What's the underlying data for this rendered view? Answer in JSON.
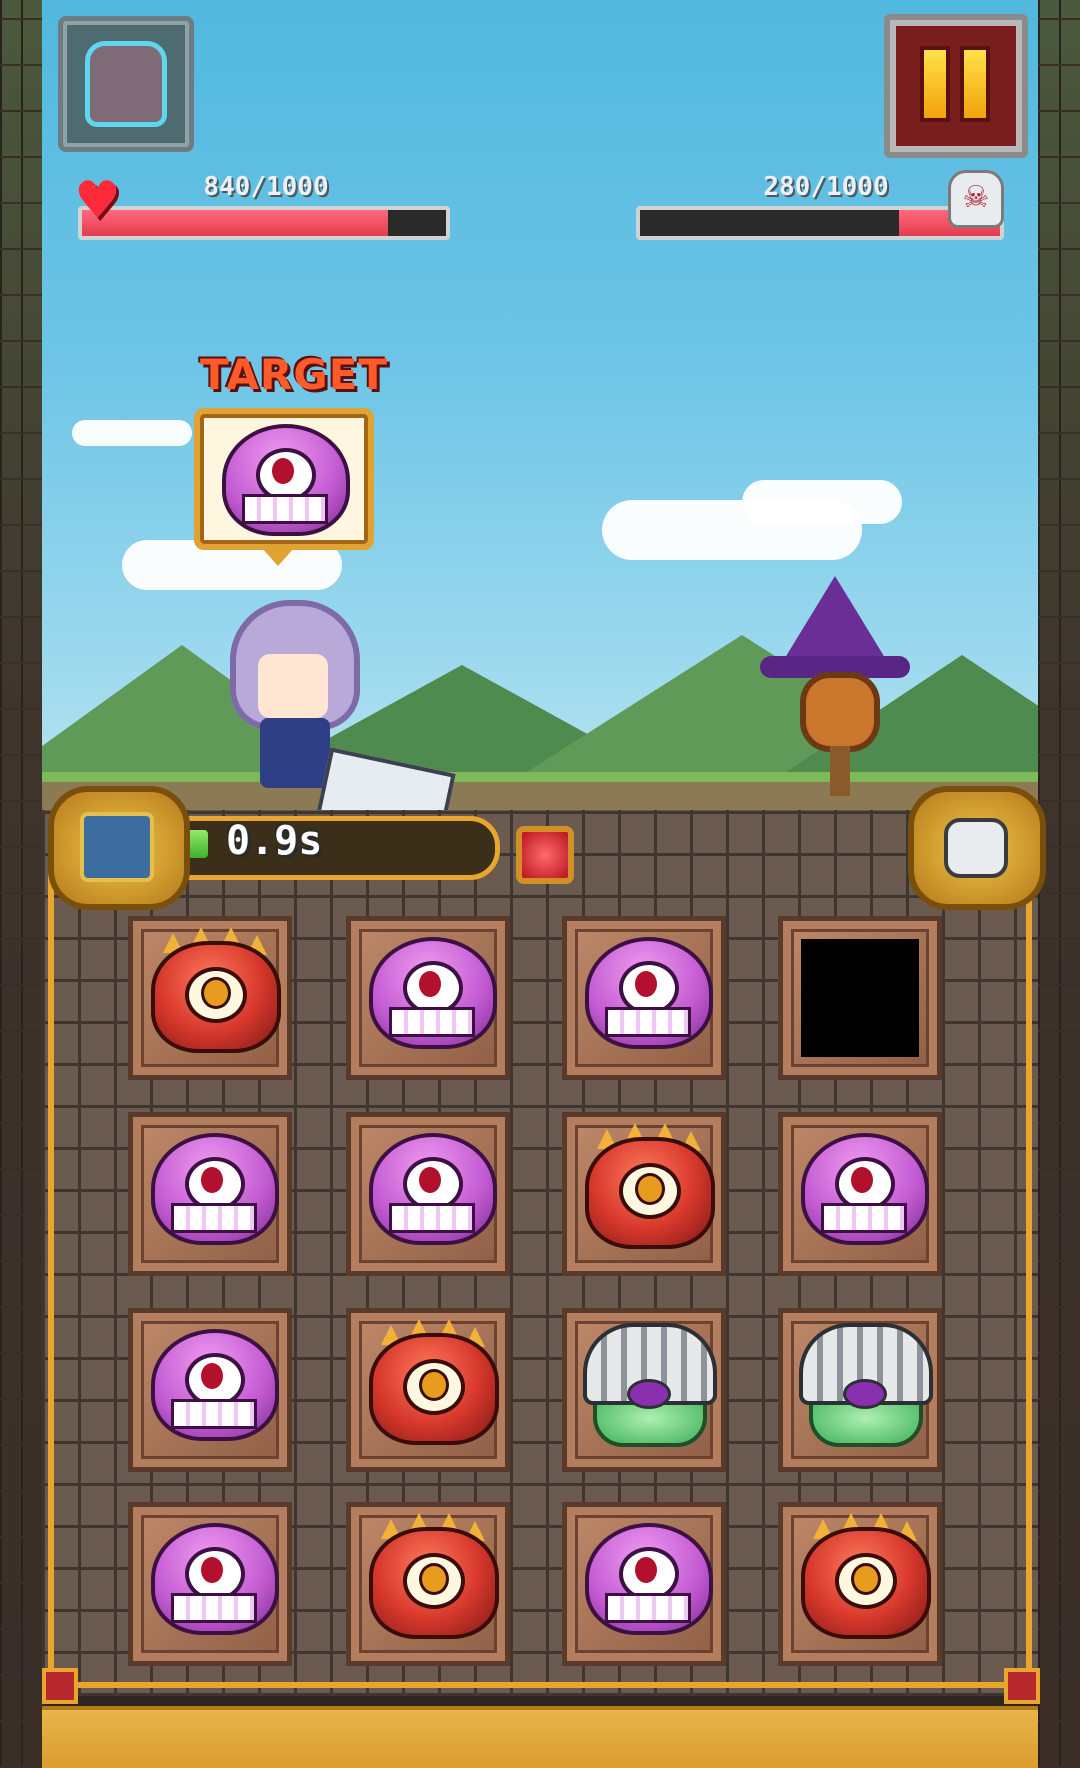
{
  "hud": {
    "player_hp_text": "840/1000",
    "player_hp_fraction": 0.84,
    "enemy_hp_text": "280/1000",
    "enemy_hp_fraction": 0.28,
    "heart_icon": "heart-icon",
    "skull_icon": "skull-icon"
  },
  "target": {
    "label": "TARGET",
    "monster": "purple-slime"
  },
  "combo": {
    "timer_text": "0.9s",
    "timer_fraction": 0.12
  },
  "board": {
    "tiles": [
      [
        "red-cyclops",
        "purple-slime",
        "purple-slime",
        "empty"
      ],
      [
        "purple-slime",
        "purple-slime",
        "red-cyclops",
        "purple-slime"
      ],
      [
        "purple-slime",
        "red-cyclops",
        "armored-knight",
        "armored-knight"
      ],
      [
        "purple-slime",
        "red-cyclops",
        "purple-slime",
        "red-cyclops"
      ]
    ]
  },
  "colors": {
    "hp_fill": "#e53a4f",
    "timer_fill": "#39b22b",
    "frame_gold": "#e9a52e",
    "pause_red": "#7a1d1d"
  }
}
